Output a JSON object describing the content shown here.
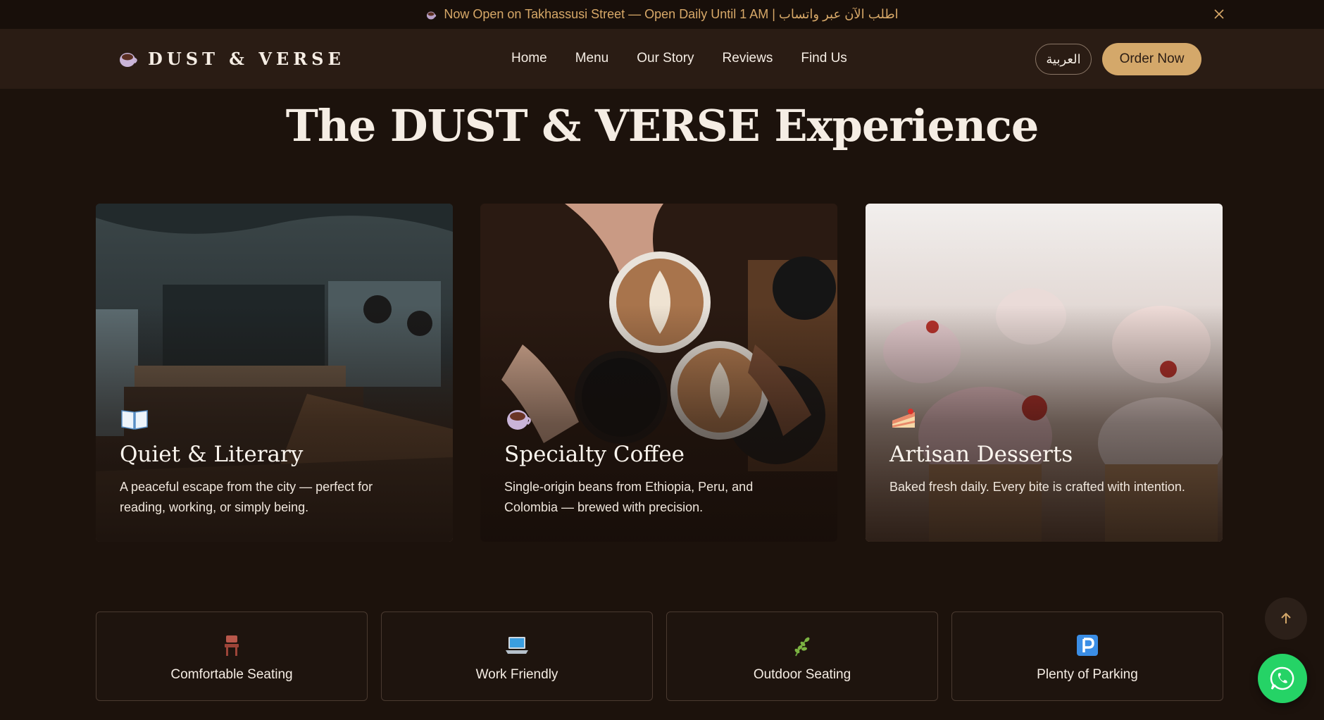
{
  "announcement": {
    "icon": "coffee-cup-icon",
    "text": "Now Open on Takhassusi Street — Open Daily Until 1 AM | اطلب الآن عبر واتساب",
    "close_icon": "close-icon"
  },
  "nav": {
    "logo_text": "DUST & VERSE",
    "links": [
      "Home",
      "Menu",
      "Our Story",
      "Reviews",
      "Find Us"
    ],
    "language_button": "العربية",
    "order_button": "Order Now"
  },
  "experience": {
    "title": "The DUST & VERSE Experience",
    "cards": [
      {
        "icon": "open-book-icon",
        "title": "Quiet & Literary",
        "description": "A peaceful escape from the city — perfect for reading, working, or simply being."
      },
      {
        "icon": "coffee-cup-icon",
        "title": "Specialty Coffee",
        "description": "Single-origin beans from Ethiopia, Peru, and Colombia — brewed with precision."
      },
      {
        "icon": "cake-slice-icon",
        "title": "Artisan Desserts",
        "description": "Baked fresh daily. Every bite is crafted with intention."
      }
    ]
  },
  "features": [
    {
      "icon": "chair-icon",
      "label": "Comfortable Seating"
    },
    {
      "icon": "laptop-icon",
      "label": "Work Friendly"
    },
    {
      "icon": "herb-icon",
      "label": "Outdoor Seating"
    },
    {
      "icon": "parking-icon",
      "label": "Plenty of Parking"
    }
  ],
  "floating": {
    "scroll_top_icon": "arrow-up-icon",
    "whatsapp_icon": "whatsapp-icon"
  },
  "colors": {
    "background": "#1c120c",
    "nav": "#2a1c14",
    "accent": "#d4a86a",
    "announcement_text": "#d7a868",
    "whatsapp": "#25d366"
  }
}
